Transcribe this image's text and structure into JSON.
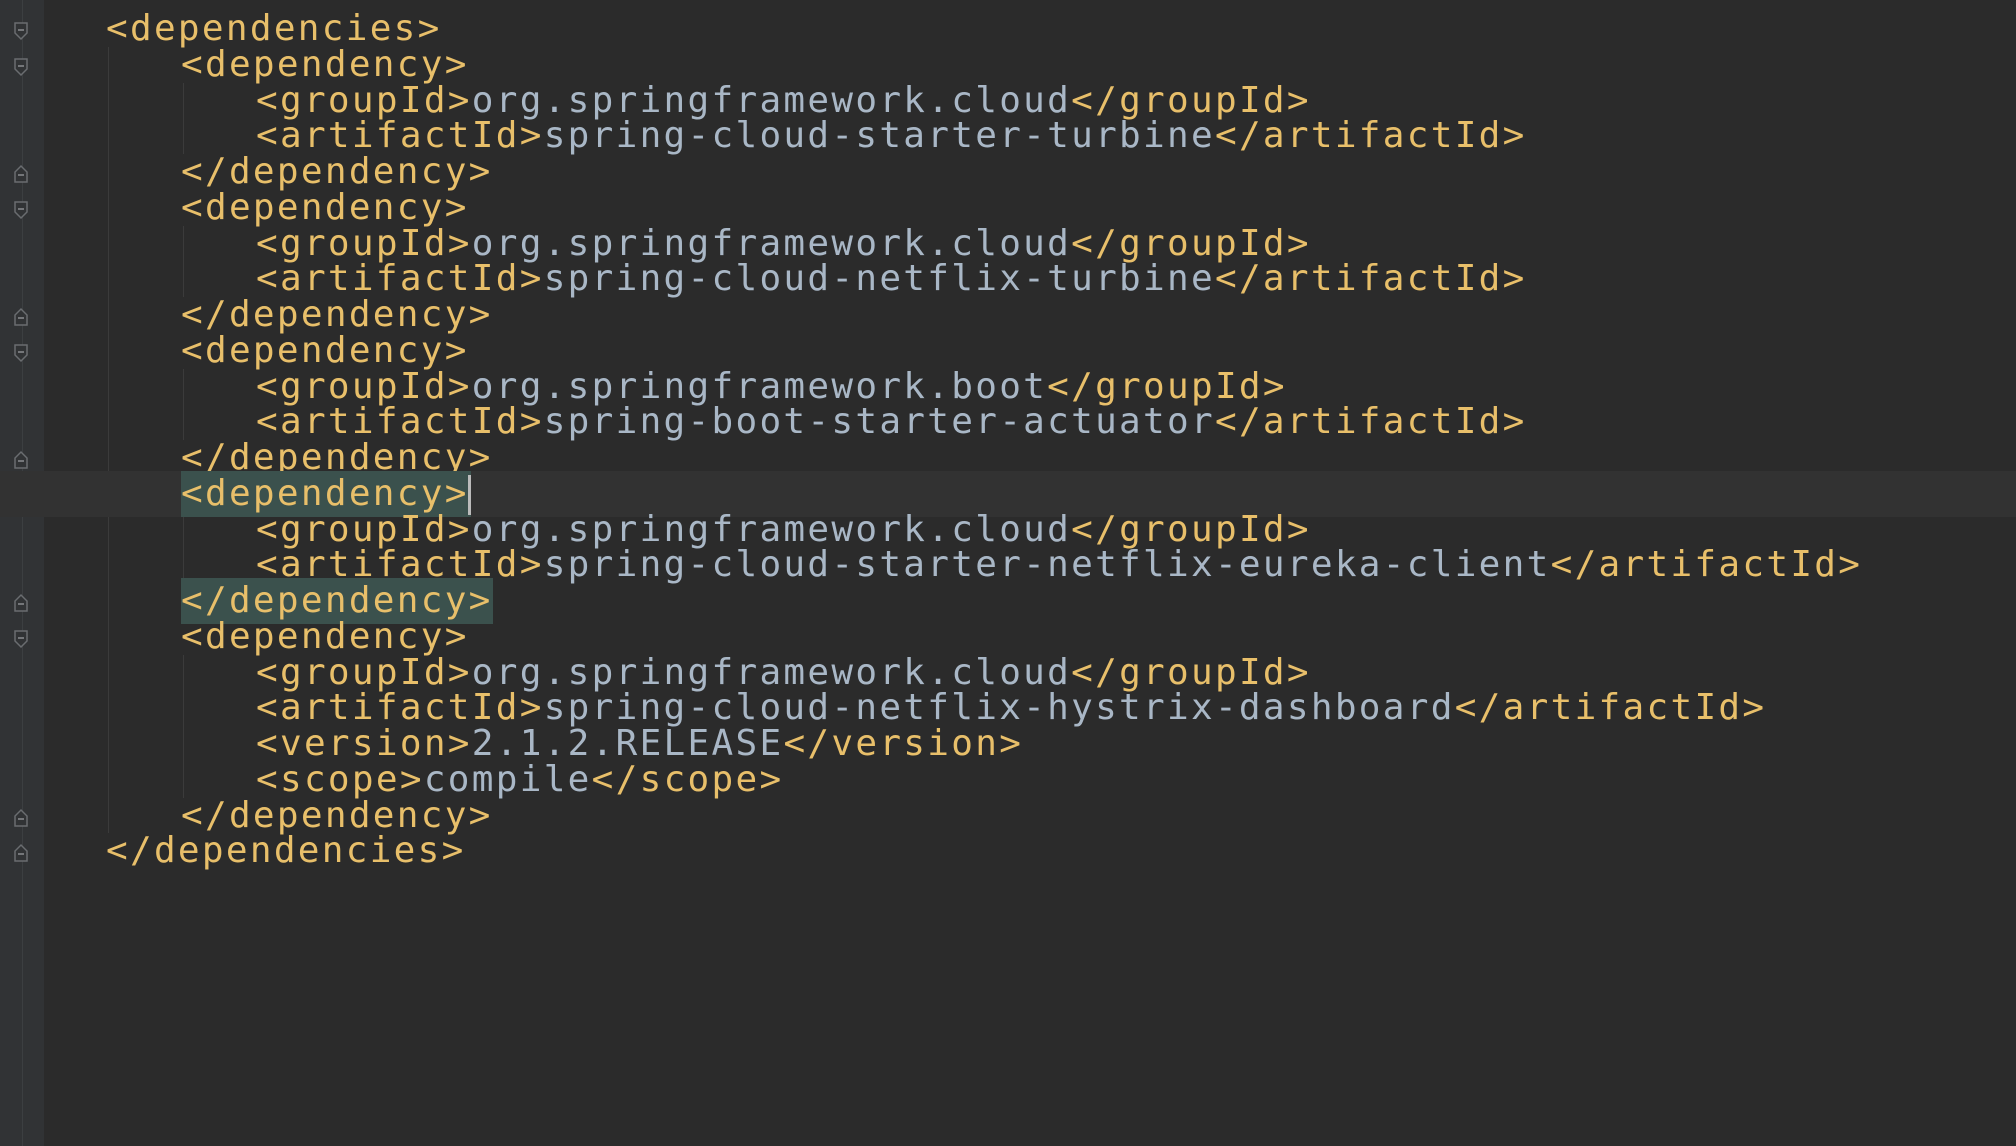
{
  "editor": {
    "language": "XML",
    "theme_colors": {
      "background": "#2b2b2b",
      "tag": "#e8bf6a",
      "text": "#a9b7c6",
      "brace_match_highlight": "#3b514d",
      "current_line": "#323232"
    },
    "lines": [
      {
        "level": 1,
        "segments": [
          [
            "tag",
            "<dependencies>"
          ]
        ]
      },
      {
        "level": 2,
        "segments": [
          [
            "tag",
            "<dependency>"
          ]
        ]
      },
      {
        "level": 3,
        "segments": [
          [
            "tag",
            "<groupId>"
          ],
          [
            "txt",
            "org.springframework.cloud"
          ],
          [
            "tag",
            "</groupId>"
          ]
        ]
      },
      {
        "level": 3,
        "segments": [
          [
            "tag",
            "<artifactId>"
          ],
          [
            "txt",
            "spring-cloud-starter-turbine"
          ],
          [
            "tag",
            "</artifactId>"
          ]
        ]
      },
      {
        "level": 2,
        "segments": [
          [
            "tag",
            "</dependency>"
          ]
        ]
      },
      {
        "level": 2,
        "segments": [
          [
            "tag",
            "<dependency>"
          ]
        ]
      },
      {
        "level": 3,
        "segments": [
          [
            "tag",
            "<groupId>"
          ],
          [
            "txt",
            "org.springframework.cloud"
          ],
          [
            "tag",
            "</groupId>"
          ]
        ]
      },
      {
        "level": 3,
        "segments": [
          [
            "tag",
            "<artifactId>"
          ],
          [
            "txt",
            "spring-cloud-netflix-turbine"
          ],
          [
            "tag",
            "</artifactId>"
          ]
        ]
      },
      {
        "level": 2,
        "segments": [
          [
            "tag",
            "</dependency>"
          ]
        ]
      },
      {
        "level": 2,
        "segments": [
          [
            "tag",
            "<dependency>"
          ]
        ]
      },
      {
        "level": 3,
        "segments": [
          [
            "tag",
            "<groupId>"
          ],
          [
            "txt",
            "org.springframework.boot"
          ],
          [
            "tag",
            "</groupId>"
          ]
        ]
      },
      {
        "level": 3,
        "segments": [
          [
            "tag",
            "<artifactId>"
          ],
          [
            "txt",
            "spring-boot-starter-actuator"
          ],
          [
            "tag",
            "</artifactId>"
          ]
        ]
      },
      {
        "level": 2,
        "segments": [
          [
            "tag",
            "</dependency>"
          ]
        ]
      },
      {
        "level": 2,
        "current": true,
        "match": true,
        "caret": true,
        "segments": [
          [
            "tag",
            "<dependency>"
          ]
        ]
      },
      {
        "level": 3,
        "segments": [
          [
            "tag",
            "<groupId>"
          ],
          [
            "txt",
            "org.springframework.cloud"
          ],
          [
            "tag",
            "</groupId>"
          ]
        ]
      },
      {
        "level": 3,
        "segments": [
          [
            "tag",
            "<artifactId>"
          ],
          [
            "txt",
            "spring-cloud-starter-netflix-eureka-client"
          ],
          [
            "tag",
            "</artifactId>"
          ]
        ]
      },
      {
        "level": 2,
        "match": true,
        "segments": [
          [
            "tag",
            "</dependency>"
          ]
        ]
      },
      {
        "level": 2,
        "segments": [
          [
            "tag",
            "<dependency>"
          ]
        ]
      },
      {
        "level": 3,
        "segments": [
          [
            "tag",
            "<groupId>"
          ],
          [
            "txt",
            "org.springframework.cloud"
          ],
          [
            "tag",
            "</groupId>"
          ]
        ]
      },
      {
        "level": 3,
        "segments": [
          [
            "tag",
            "<artifactId>"
          ],
          [
            "txt",
            "spring-cloud-netflix-hystrix-dashboard"
          ],
          [
            "tag",
            "</artifactId>"
          ]
        ]
      },
      {
        "level": 3,
        "segments": [
          [
            "tag",
            "<version>"
          ],
          [
            "txt",
            "2.1.2.RELEASE"
          ],
          [
            "tag",
            "</version>"
          ]
        ]
      },
      {
        "level": 3,
        "segments": [
          [
            "tag",
            "<scope>"
          ],
          [
            "txt",
            "compile"
          ],
          [
            "tag",
            "</scope>"
          ]
        ]
      },
      {
        "level": 2,
        "segments": [
          [
            "tag",
            "</dependency>"
          ]
        ]
      },
      {
        "level": 1,
        "segments": [
          [
            "tag",
            "</dependencies>"
          ]
        ]
      }
    ],
    "fold_markers": [
      {
        "line": 0,
        "kind": "open"
      },
      {
        "line": 1,
        "kind": "open"
      },
      {
        "line": 4,
        "kind": "close"
      },
      {
        "line": 5,
        "kind": "open"
      },
      {
        "line": 8,
        "kind": "close"
      },
      {
        "line": 9,
        "kind": "open"
      },
      {
        "line": 12,
        "kind": "close"
      },
      {
        "line": 13,
        "kind": "open"
      },
      {
        "line": 16,
        "kind": "close"
      },
      {
        "line": 17,
        "kind": "open"
      },
      {
        "line": 22,
        "kind": "close"
      },
      {
        "line": 23,
        "kind": "close"
      }
    ],
    "indent_guides": [
      {
        "level": 1,
        "from_line": 1,
        "to_line": 22
      },
      {
        "level": 2,
        "from_line": 2,
        "to_line": 3
      },
      {
        "level": 2,
        "from_line": 6,
        "to_line": 7
      },
      {
        "level": 2,
        "from_line": 10,
        "to_line": 11
      },
      {
        "level": 2,
        "from_line": 14,
        "to_line": 15
      },
      {
        "level": 2,
        "from_line": 18,
        "to_line": 21
      }
    ]
  }
}
